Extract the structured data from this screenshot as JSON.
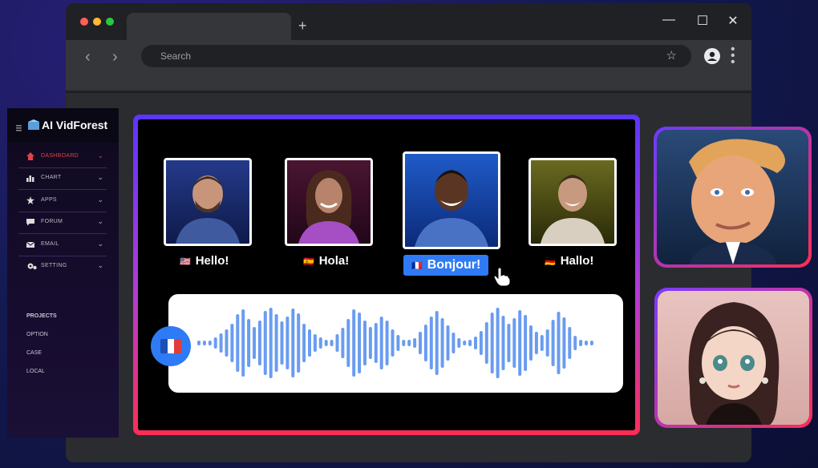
{
  "browser": {
    "search_placeholder": "Search",
    "new_tab": "+",
    "minimize": "—",
    "maximize": "☐",
    "close": "✕",
    "back": "‹",
    "forward": "›",
    "bookmark": "☆"
  },
  "app": {
    "brand": "AI VidForest",
    "menu": [
      {
        "label": "DASHBOARD",
        "icon": "home-icon",
        "active": true
      },
      {
        "label": "CHART",
        "icon": "chart-icon",
        "active": false
      },
      {
        "label": "APPS",
        "icon": "star-icon",
        "active": false
      },
      {
        "label": "FORUM",
        "icon": "chat-icon",
        "active": false
      },
      {
        "label": "EMAIL",
        "icon": "mail-icon",
        "active": false
      },
      {
        "label": "SETTING",
        "icon": "gear-icon",
        "active": false
      }
    ],
    "projects_heading": "PROJECTS",
    "projects": [
      "OPTION",
      "CASE",
      "LOCAL"
    ]
  },
  "translation": {
    "greetings": [
      {
        "flag": "🇺🇸",
        "text": "Hello!",
        "active": false
      },
      {
        "flag": "🇪🇸",
        "text": "Hola!",
        "active": false
      },
      {
        "flag": "🇫🇷",
        "text": "Bonjour!",
        "active": true
      },
      {
        "flag": "🇩🇪",
        "text": "Hallo!",
        "active": false
      }
    ]
  },
  "colors": {
    "accent": "#2f7bf5",
    "active_menu": "#e2424b",
    "stage_gradient_top": "#5a35ff",
    "stage_gradient_bottom": "#ff2d55"
  }
}
